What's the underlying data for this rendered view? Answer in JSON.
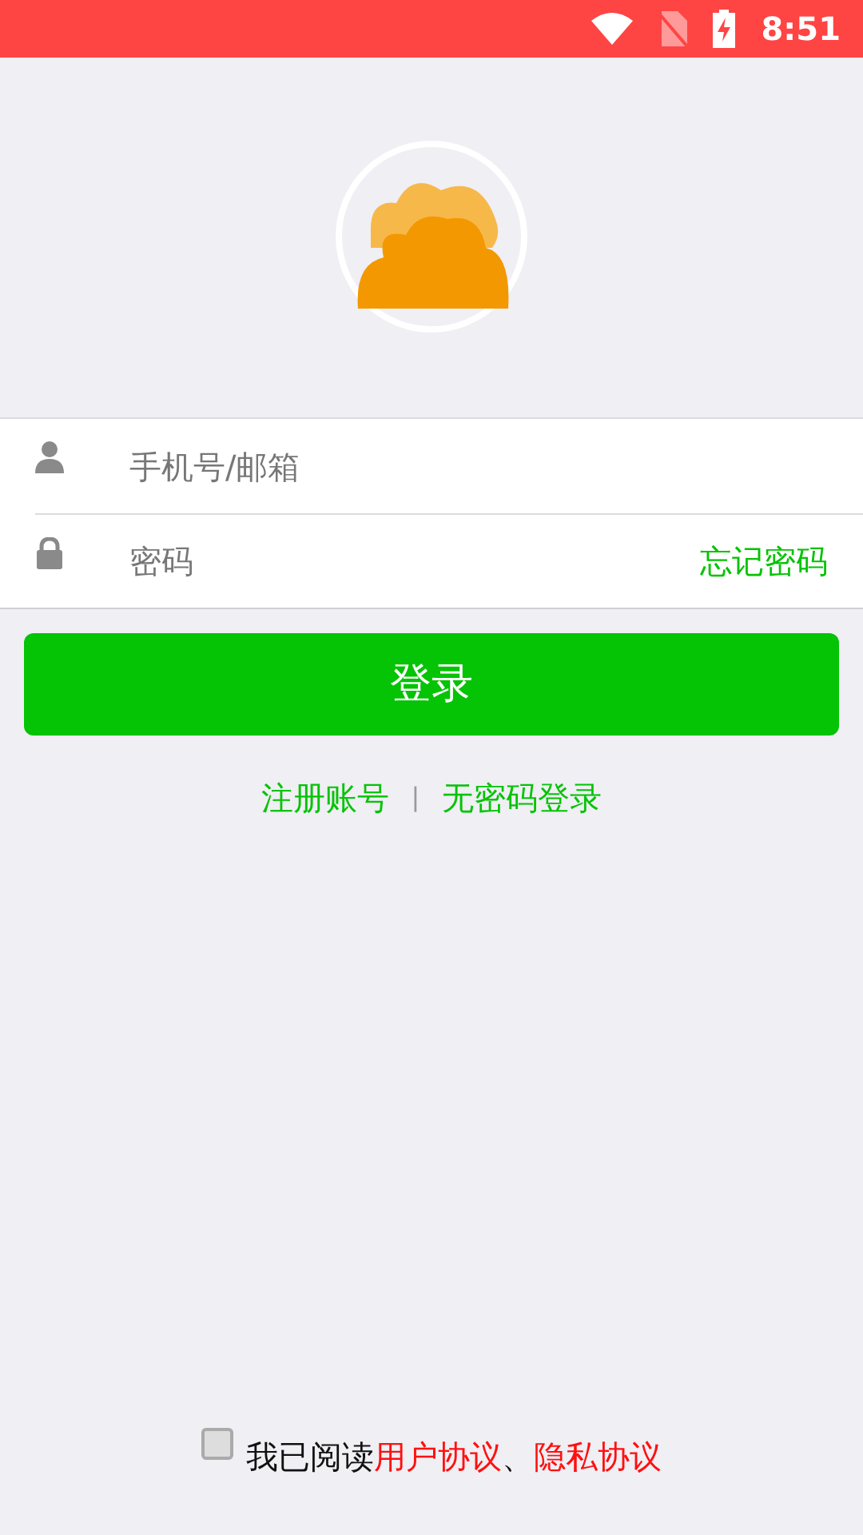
{
  "status_bar": {
    "time": "8:51"
  },
  "form": {
    "account": {
      "placeholder": "手机号/邮箱"
    },
    "password": {
      "placeholder": "密码"
    },
    "forgot_link": "忘记密码"
  },
  "login_button": "登录",
  "links": [
    {
      "label": "注册账号"
    },
    {
      "label": "无密码登录"
    }
  ],
  "link_separator": "|",
  "agreement": {
    "checked": false,
    "parts": [
      {
        "kind": "text",
        "text": "我已阅读"
      },
      {
        "kind": "link",
        "text": "用户协议"
      },
      {
        "kind": "text",
        "text": "、"
      },
      {
        "kind": "link",
        "text": "隐私协议"
      }
    ]
  }
}
